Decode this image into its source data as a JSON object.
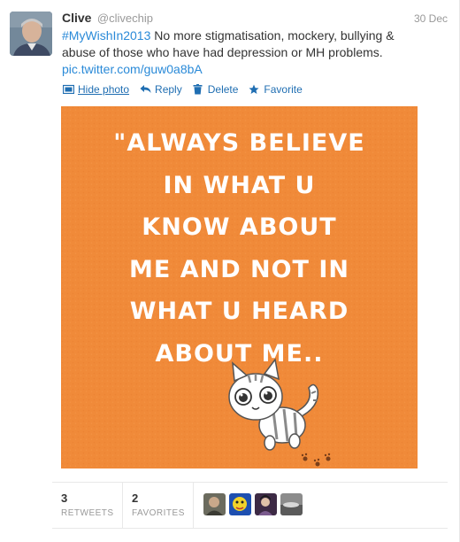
{
  "tweet": {
    "fullname": "Clive",
    "username": "@clivechip",
    "timestamp": "30 Dec",
    "hashtag": "#MyWishIn2013",
    "text_line1_rest": " No more stigmatisation, mockery, bullying &",
    "text_line2": "abuse of those who have had depression or MH problems.",
    "pic_link": "pic.twitter.com/guw0a8bA"
  },
  "actions": {
    "hide_photo": "Hide photo",
    "reply": "Reply",
    "delete": "Delete",
    "favorite": "Favorite"
  },
  "media": {
    "quote_lines": [
      "\"ALWAYS BELIEVE",
      "IN WHAT U",
      "KNOW ABOUT",
      "ME AND NOT IN",
      "WHAT U HEARD",
      "ABOUT ME.."
    ],
    "background_color": "#f08a39"
  },
  "stats": {
    "retweets_count": "3",
    "retweets_label": "RETWEETS",
    "favorites_count": "2",
    "favorites_label": "FAVORITES"
  },
  "colors": {
    "link": "#2a8ad8",
    "action": "#1f6eb2",
    "muted": "#999999"
  },
  "icons": {
    "hide_photo": "photo-icon",
    "reply": "reply-arrow-icon",
    "delete": "trash-icon",
    "favorite": "star-icon"
  }
}
